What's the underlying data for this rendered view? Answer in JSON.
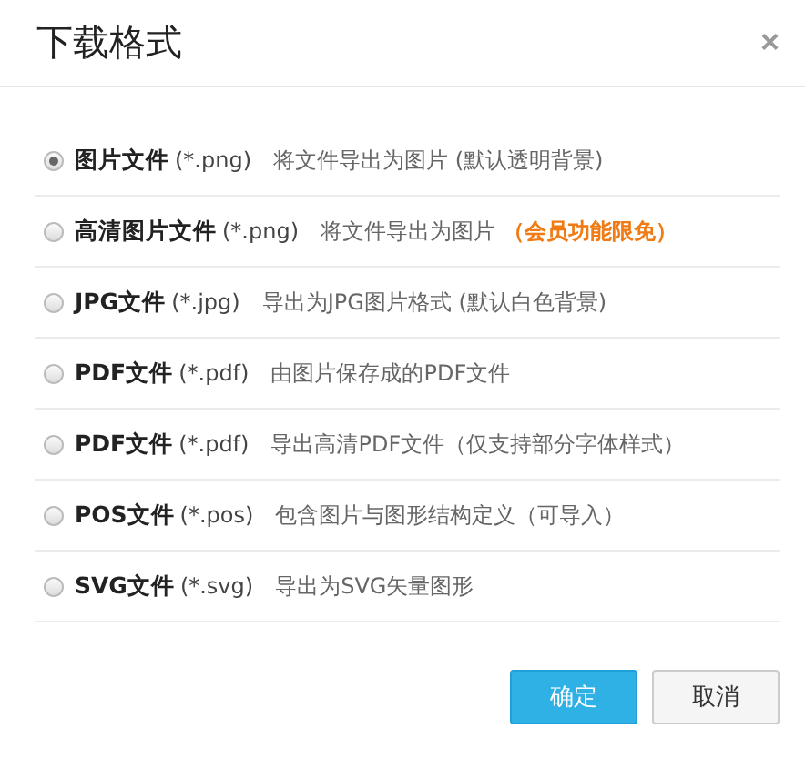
{
  "dialog": {
    "title": "下载格式",
    "close": "×"
  },
  "options": [
    {
      "name": "图片文件",
      "ext": "(*.png)",
      "desc": "将文件导出为图片 (默认透明背景)",
      "selected": true
    },
    {
      "name": "高清图片文件",
      "ext": "(*.png)",
      "desc": "将文件导出为图片",
      "note": "（会员功能限免）",
      "selected": false
    },
    {
      "name": "JPG文件",
      "ext": "(*.jpg)",
      "desc": "导出为JPG图片格式 (默认白色背景)",
      "selected": false
    },
    {
      "name": "PDF文件",
      "ext": "(*.pdf)",
      "desc": "由图片保存成的PDF文件",
      "selected": false
    },
    {
      "name": "PDF文件",
      "ext": "(*.pdf)",
      "desc": "导出高清PDF文件（仅支持部分字体样式）",
      "selected": false
    },
    {
      "name": "POS文件",
      "ext": "(*.pos)",
      "desc": "包含图片与图形结构定义（可导入）",
      "selected": false
    },
    {
      "name": "SVG文件",
      "ext": "(*.svg)",
      "desc": "导出为SVG矢量图形",
      "selected": false
    }
  ],
  "buttons": [
    {
      "label": "确定",
      "kind": "primary"
    },
    {
      "label": "取消",
      "kind": "secondary"
    }
  ]
}
